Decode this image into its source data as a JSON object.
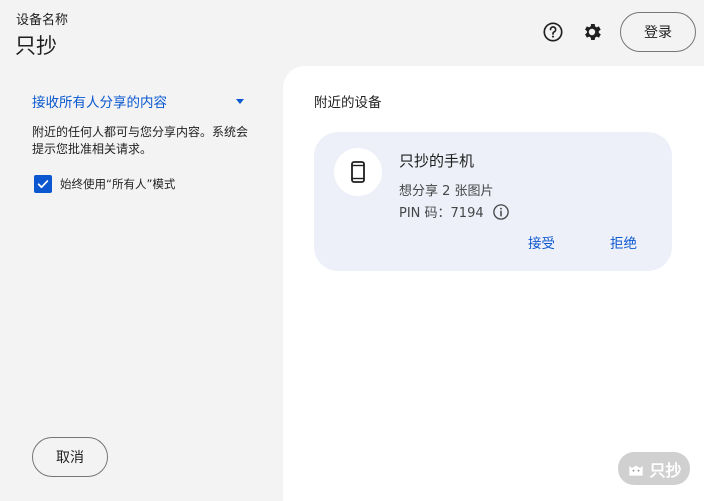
{
  "header": {
    "device_label": "设备名称",
    "device_name": "只抄",
    "login_label": "登录"
  },
  "icons": {
    "help": "help-icon",
    "settings": "gear-icon",
    "phone": "smartphone-icon",
    "info": "info-icon",
    "checkbox": "check-icon"
  },
  "left": {
    "visibility_selected": "接收所有人分享的内容",
    "description": "附近的任何人都可与您分享内容。系统会提示您批准相关请求。",
    "always_everyone_label": "始终使用“所有人”模式",
    "always_everyone_checked": true,
    "cancel_label": "取消"
  },
  "right": {
    "nearby_title": "附近的设备",
    "card": {
      "device_name": "只抄的手机",
      "want_share": "想分享 2 张图片",
      "pin_text": "PIN 码：7194",
      "accept_label": "接受",
      "decline_label": "拒绝"
    }
  },
  "watermark": {
    "text": "只抄"
  },
  "colors": {
    "accent": "#0b57d0",
    "background": "#f3f3f3",
    "panel": "#ffffff",
    "card": "#eef0f9"
  }
}
